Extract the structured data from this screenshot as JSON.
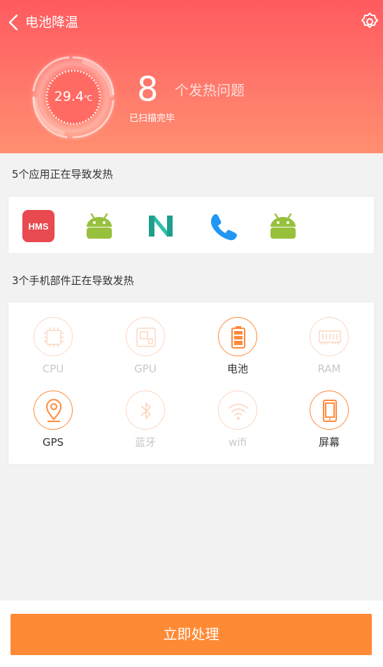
{
  "header": {
    "title": "电池降温",
    "back_icon": "chevron-left-icon",
    "settings_icon": "gear-icon"
  },
  "summary": {
    "temperature": "29.4",
    "temperature_unit": "℃",
    "issue_count": "8",
    "issue_label": "个发热问题",
    "scan_status": "已扫描完毕"
  },
  "apps_section": {
    "title": "5个应用正在导致发热",
    "apps": [
      {
        "icon": "hms-app-icon",
        "text": "HMS",
        "color": "#e84a4f"
      },
      {
        "icon": "android-app-icon",
        "color": "#97c03c"
      },
      {
        "icon": "n-logo-app-icon",
        "color": "#1f9e8d"
      },
      {
        "icon": "phone-app-icon",
        "color": "#2196f3"
      },
      {
        "icon": "android-app-icon",
        "color": "#97c03c"
      }
    ]
  },
  "parts_section": {
    "title": "3个手机部件正在导致发热",
    "parts": [
      {
        "label": "CPU",
        "icon": "cpu-icon",
        "active": false
      },
      {
        "label": "GPU",
        "icon": "gpu-icon",
        "active": false
      },
      {
        "label": "电池",
        "icon": "battery-icon",
        "active": true
      },
      {
        "label": "RAM",
        "icon": "ram-icon",
        "active": false
      },
      {
        "label": "GPS",
        "icon": "location-pin-icon",
        "active": true
      },
      {
        "label": "蓝牙",
        "icon": "bluetooth-icon",
        "active": false
      },
      {
        "label": "wifi",
        "icon": "wifi-icon",
        "active": false
      },
      {
        "label": "屏幕",
        "icon": "screen-icon",
        "active": true
      }
    ]
  },
  "action": {
    "label": "立即处理"
  },
  "colors": {
    "header_top": "#ff5a5f",
    "header_bottom": "#ff8f70",
    "accent": "#ff8a36",
    "inactive": "#fbd7c3"
  }
}
